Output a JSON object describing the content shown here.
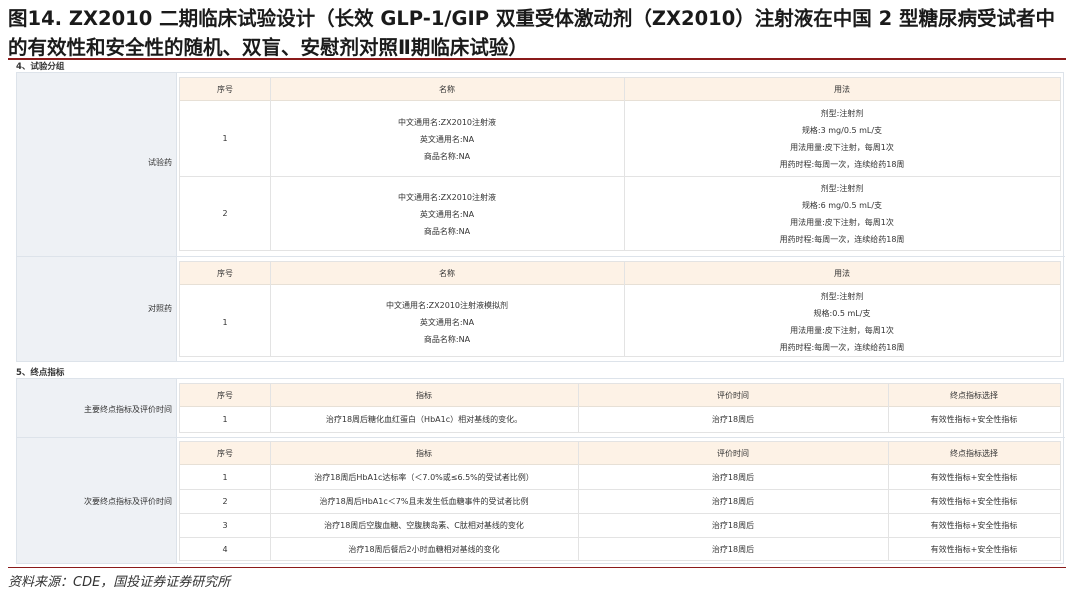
{
  "figure": {
    "title": "图14. ZX2010 二期临床试验设计（长效 GLP-1/GIP 双重受体激动剂（ZX2010）注射液在中国 2 型糖尿病受试者中的有效性和安全性的随机、双盲、安慰剂对照Ⅱ期临床试验）",
    "source": "资料来源：CDE，国投证券证券研究所"
  },
  "section4": {
    "label": "4、试验分组",
    "test_drug": {
      "group_label": "试验药",
      "headers": [
        "序号",
        "名称",
        "用法"
      ],
      "rows": [
        {
          "no": "1",
          "name": [
            "中文通用名:ZX2010注射液",
            "英文通用名:NA",
            "商品名称:NA"
          ],
          "usage": [
            "剂型:注射剂",
            "规格:3 mg/0.5 mL/支",
            "用法用量:皮下注射，每周1次",
            "用药时程:每周一次，连续给药18周"
          ]
        },
        {
          "no": "2",
          "name": [
            "中文通用名:ZX2010注射液",
            "英文通用名:NA",
            "商品名称:NA"
          ],
          "usage": [
            "剂型:注射剂",
            "规格:6 mg/0.5 mL/支",
            "用法用量:皮下注射，每周1次",
            "用药时程:每周一次，连续给药18周"
          ]
        }
      ]
    },
    "control_drug": {
      "group_label": "对照药",
      "headers": [
        "序号",
        "名称",
        "用法"
      ],
      "rows": [
        {
          "no": "1",
          "name": [
            "中文通用名:ZX2010注射液模拟剂",
            "英文通用名:NA",
            "商品名称:NA"
          ],
          "usage": [
            "剂型:注射剂",
            "规格:0.5 mL/支",
            "用法用量:皮下注射，每周1次",
            "用药时程:每周一次，连续给药18周"
          ]
        }
      ]
    }
  },
  "section5": {
    "label": "5、终点指标",
    "primary": {
      "group_label": "主要终点指标及评价时间",
      "headers": [
        "序号",
        "指标",
        "评价时间",
        "终点指标选择"
      ],
      "rows": [
        {
          "no": "1",
          "indicator": "治疗18周后糖化血红蛋白（HbA1c）相对基线的变化。",
          "time": "治疗18周后",
          "choice": "有效性指标+安全性指标"
        }
      ]
    },
    "secondary": {
      "group_label": "次要终点指标及评价时间",
      "headers": [
        "序号",
        "指标",
        "评价时间",
        "终点指标选择"
      ],
      "rows": [
        {
          "no": "1",
          "indicator": "治疗18周后HbA1c达标率（＜7.0%或≤6.5%的受试者比例）",
          "time": "治疗18周后",
          "choice": "有效性指标+安全性指标"
        },
        {
          "no": "2",
          "indicator": "治疗18周后HbA1c＜7%且未发生低血糖事件的受试者比例",
          "time": "治疗18周后",
          "choice": "有效性指标+安全性指标"
        },
        {
          "no": "3",
          "indicator": "治疗18周后空腹血糖、空腹胰岛素、C肽相对基线的变化",
          "time": "治疗18周后",
          "choice": "有效性指标+安全性指标"
        },
        {
          "no": "4",
          "indicator": "治疗18周后餐后2小时血糖相对基线的变化",
          "time": "治疗18周后",
          "choice": "有效性指标+安全性指标"
        }
      ]
    }
  }
}
